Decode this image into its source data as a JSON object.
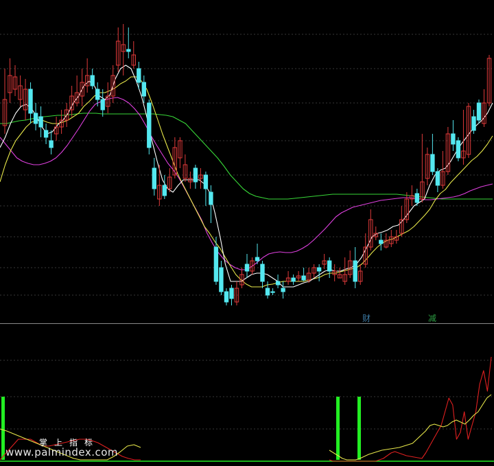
{
  "chart_data": {
    "type": "candlestick",
    "title": "",
    "grid": true,
    "colors": {
      "background": "#000000",
      "up_candle": "#e03a3a",
      "down_candle": "#54e8f0",
      "ma5": "#ffffff",
      "ma10": "#e8e84a",
      "ma20": "#e040e0",
      "ma60": "#38d838",
      "osc_red": "#e02020",
      "osc_yellow": "#e8e84a",
      "signal_bar": "#22ee22",
      "grid": "#6e6e6e",
      "divider": "#8a8a8a"
    },
    "candles": [
      [
        183,
        145,
        100,
        195
      ],
      [
        135,
        110,
        85,
        150
      ],
      [
        130,
        112,
        95,
        140
      ],
      [
        145,
        125,
        110,
        155
      ],
      [
        160,
        130,
        115,
        175
      ],
      [
        130,
        165,
        120,
        180
      ],
      [
        165,
        180,
        150,
        190
      ],
      [
        170,
        185,
        155,
        200
      ],
      [
        190,
        200,
        180,
        210
      ],
      [
        205,
        215,
        190,
        225
      ],
      [
        195,
        185,
        170,
        205
      ],
      [
        185,
        175,
        160,
        195
      ],
      [
        175,
        160,
        150,
        185
      ],
      [
        160,
        140,
        125,
        170
      ],
      [
        150,
        135,
        110,
        155
      ],
      [
        140,
        120,
        100,
        155
      ],
      [
        125,
        110,
        85,
        135
      ],
      [
        110,
        125,
        100,
        130
      ],
      [
        130,
        145,
        120,
        155
      ],
      [
        145,
        160,
        130,
        170
      ],
      [
        155,
        140,
        120,
        165
      ],
      [
        140,
        110,
        95,
        150
      ],
      [
        95,
        60,
        40,
        105
      ],
      [
        75,
        65,
        35,
        110
      ],
      [
        72,
        75,
        40,
        85
      ],
      [
        95,
        80,
        60,
        100
      ],
      [
        100,
        120,
        90,
        130
      ],
      [
        120,
        140,
        110,
        150
      ],
      [
        150,
        215,
        145,
        225
      ],
      [
        245,
        275,
        230,
        285
      ],
      [
        290,
        270,
        240,
        300
      ],
      [
        270,
        285,
        255,
        290
      ],
      [
        275,
        258,
        245,
        280
      ],
      [
        255,
        215,
        200,
        260
      ],
      [
        230,
        205,
        200,
        245
      ],
      [
        260,
        240,
        225,
        265
      ],
      [
        265,
        260,
        250,
        275
      ],
      [
        245,
        265,
        240,
        275
      ],
      [
        260,
        255,
        245,
        275
      ],
      [
        255,
        275,
        250,
        300
      ],
      [
        280,
        298,
        270,
        325
      ],
      [
        360,
        410,
        345,
        415
      ],
      [
        390,
        425,
        380,
        430
      ],
      [
        425,
        440,
        420,
        445
      ],
      [
        420,
        435,
        415,
        445
      ],
      [
        440,
        420,
        410,
        445
      ],
      [
        415,
        400,
        390,
        420
      ],
      [
        385,
        395,
        370,
        405
      ],
      [
        395,
        380,
        375,
        400
      ],
      [
        375,
        380,
        355,
        385
      ],
      [
        385,
        410,
        380,
        420
      ],
      [
        420,
        430,
        410,
        435
      ],
      [
        425,
        425,
        420,
        430
      ],
      [
        410,
        415,
        400,
        420
      ],
      [
        420,
        425,
        410,
        435
      ],
      [
        410,
        405,
        395,
        415
      ],
      [
        405,
        410,
        400,
        415
      ],
      [
        405,
        402,
        395,
        410
      ],
      [
        402,
        408,
        390,
        410
      ],
      [
        408,
        398,
        390,
        412
      ],
      [
        398,
        390,
        385,
        405
      ],
      [
        390,
        395,
        385,
        410
      ],
      [
        385,
        380,
        370,
        392
      ],
      [
        380,
        395,
        375,
        405
      ],
      [
        400,
        395,
        385,
        410
      ],
      [
        405,
        400,
        390,
        405
      ],
      [
        410,
        400,
        375,
        415
      ],
      [
        400,
        380,
        365,
        405
      ],
      [
        380,
        410,
        360,
        420
      ],
      [
        410,
        395,
        385,
        415
      ],
      [
        385,
        360,
        340,
        390
      ],
      [
        360,
        320,
        305,
        365
      ],
      [
        345,
        340,
        330,
        350
      ],
      [
        350,
        355,
        340,
        365
      ],
      [
        360,
        350,
        340,
        362
      ],
      [
        355,
        345,
        335,
        360
      ],
      [
        350,
        345,
        335,
        355
      ],
      [
        340,
        320,
        300,
        345
      ],
      [
        320,
        290,
        280,
        325
      ],
      [
        290,
        285,
        270,
        300
      ],
      [
        282,
        295,
        275,
        300
      ],
      [
        290,
        265,
        195,
        295
      ],
      [
        260,
        225,
        215,
        270
      ],
      [
        225,
        250,
        195,
        255
      ],
      [
        250,
        270,
        245,
        280
      ],
      [
        270,
        250,
        220,
        275
      ],
      [
        250,
        195,
        185,
        255
      ],
      [
        195,
        210,
        175,
        220
      ],
      [
        205,
        230,
        200,
        235
      ],
      [
        230,
        220,
        160,
        240
      ],
      [
        225,
        155,
        150,
        230
      ],
      [
        170,
        190,
        160,
        195
      ],
      [
        150,
        175,
        145,
        180
      ],
      [
        180,
        150,
        130,
        185
      ],
      [
        150,
        85,
        80,
        155
      ]
    ],
    "ma5": [
      215,
      200,
      180,
      165,
      155,
      152,
      158,
      170,
      185,
      195,
      192,
      182,
      175,
      165,
      150,
      140,
      125,
      118,
      125,
      140,
      145,
      138,
      115,
      100,
      95,
      100,
      118,
      140,
      170,
      205,
      235,
      262,
      275,
      280,
      270,
      262,
      262,
      262,
      262,
      268,
      280,
      310,
      345,
      385,
      410,
      410,
      410,
      405,
      400,
      398,
      398,
      400,
      405,
      410,
      418,
      418,
      418,
      415,
      412,
      410,
      405,
      400,
      395,
      393,
      395,
      395,
      392,
      390,
      385,
      375,
      360,
      345,
      340,
      338,
      335,
      330,
      328,
      320,
      310,
      300,
      295,
      290,
      270,
      255,
      248,
      245,
      235,
      222,
      210,
      200,
      190,
      182,
      175,
      165,
      150
    ],
    "ma10": [
      265,
      240,
      220,
      205,
      195,
      185,
      178,
      176,
      175,
      178,
      180,
      180,
      178,
      175,
      170,
      165,
      155,
      148,
      140,
      135,
      135,
      132,
      128,
      122,
      118,
      112,
      112,
      118,
      130,
      150,
      172,
      195,
      215,
      235,
      255,
      270,
      285,
      300,
      315,
      330,
      340,
      352,
      362,
      375,
      388,
      400,
      408,
      414,
      418,
      418,
      418,
      415,
      414,
      412,
      410,
      410,
      410,
      410,
      410,
      408,
      406,
      404,
      400,
      398,
      398,
      396,
      394,
      392,
      390,
      385,
      377,
      368,
      360,
      354,
      350,
      348,
      344,
      340,
      336,
      330,
      322,
      314,
      305,
      292,
      282,
      276,
      266,
      258,
      250,
      242,
      234,
      228,
      220,
      210,
      198
    ],
    "ma20": [
      200,
      210,
      220,
      230,
      235,
      238,
      240,
      240,
      238,
      235,
      230,
      222,
      212,
      200,
      188,
      175,
      162,
      152,
      148,
      145,
      143,
      142,
      145,
      150,
      158,
      168,
      182,
      198,
      212,
      225,
      238,
      248,
      260,
      275,
      290,
      305,
      320,
      340,
      355,
      368,
      378,
      385,
      390,
      393,
      393,
      388,
      382,
      375,
      370,
      368,
      367,
      368,
      368,
      366,
      362,
      357,
      350,
      342,
      334,
      325,
      316,
      310,
      306,
      302,
      300,
      298,
      296,
      294,
      292,
      291,
      290,
      289,
      288,
      288,
      289,
      290,
      291,
      291,
      290,
      289,
      288,
      287,
      285,
      282,
      278,
      275,
      272,
      270,
      268
    ],
    "ma60": [
      180,
      180,
      178,
      176,
      175,
      173,
      171,
      170,
      169,
      168,
      168,
      167,
      166,
      165,
      165,
      165,
      166,
      166,
      166,
      166,
      166,
      166,
      166,
      166,
      166,
      167,
      168,
      170,
      175,
      180,
      190,
      200,
      210,
      220,
      230,
      242,
      255,
      265,
      275,
      282,
      286,
      288,
      290,
      290,
      290,
      290,
      289,
      288,
      287,
      286,
      285,
      284,
      283,
      283,
      283,
      283,
      283,
      283,
      283,
      283,
      283,
      283,
      283,
      284,
      285,
      286,
      287,
      288,
      289,
      290,
      290,
      290,
      290,
      290,
      290,
      290,
      290,
      290
    ],
    "osc_red": [
      670,
      660,
      650,
      640,
      640,
      640,
      645,
      650,
      650,
      648,
      646,
      644,
      642,
      640,
      640,
      642,
      645,
      650,
      655,
      660,
      665,
      668,
      670,
      670,
      670,
      672,
      672,
      672,
      672,
      672,
      672,
      672,
      672,
      672,
      672,
      672,
      672,
      670,
      668,
      664,
      660,
      658,
      660,
      662,
      664,
      665,
      666,
      667,
      668,
      660,
      650,
      640,
      630,
      620,
      600,
      580,
      590,
      640,
      630,
      600,
      640,
      620,
      600,
      560,
      540,
      570,
      520
    ],
    "osc_yellow": [
      625,
      628,
      632,
      636,
      640,
      644,
      648,
      652,
      656,
      660,
      664,
      668,
      670,
      670,
      670,
      670,
      670,
      665,
      658,
      650,
      648,
      652,
      656,
      660,
      664,
      668,
      670,
      670,
      670,
      668,
      665,
      662,
      660,
      658,
      656,
      655,
      654,
      653,
      652,
      650,
      648,
      646,
      640,
      634,
      628,
      620,
      618,
      620,
      622,
      620,
      615,
      612,
      615,
      618,
      612,
      605,
      600,
      590,
      580,
      575
    ],
    "signal_bars": [
      [
        2,
        578,
        670
      ],
      [
        490,
        578,
        670
      ],
      [
        521,
        578,
        670
      ]
    ],
    "markers": [
      {
        "text": "财",
        "color": "#3c7aa4"
      },
      {
        "text": "减",
        "color": "#2c9c42"
      }
    ]
  },
  "watermark": {
    "site": "www.palmindex.com",
    "brand": "掌上指标"
  }
}
